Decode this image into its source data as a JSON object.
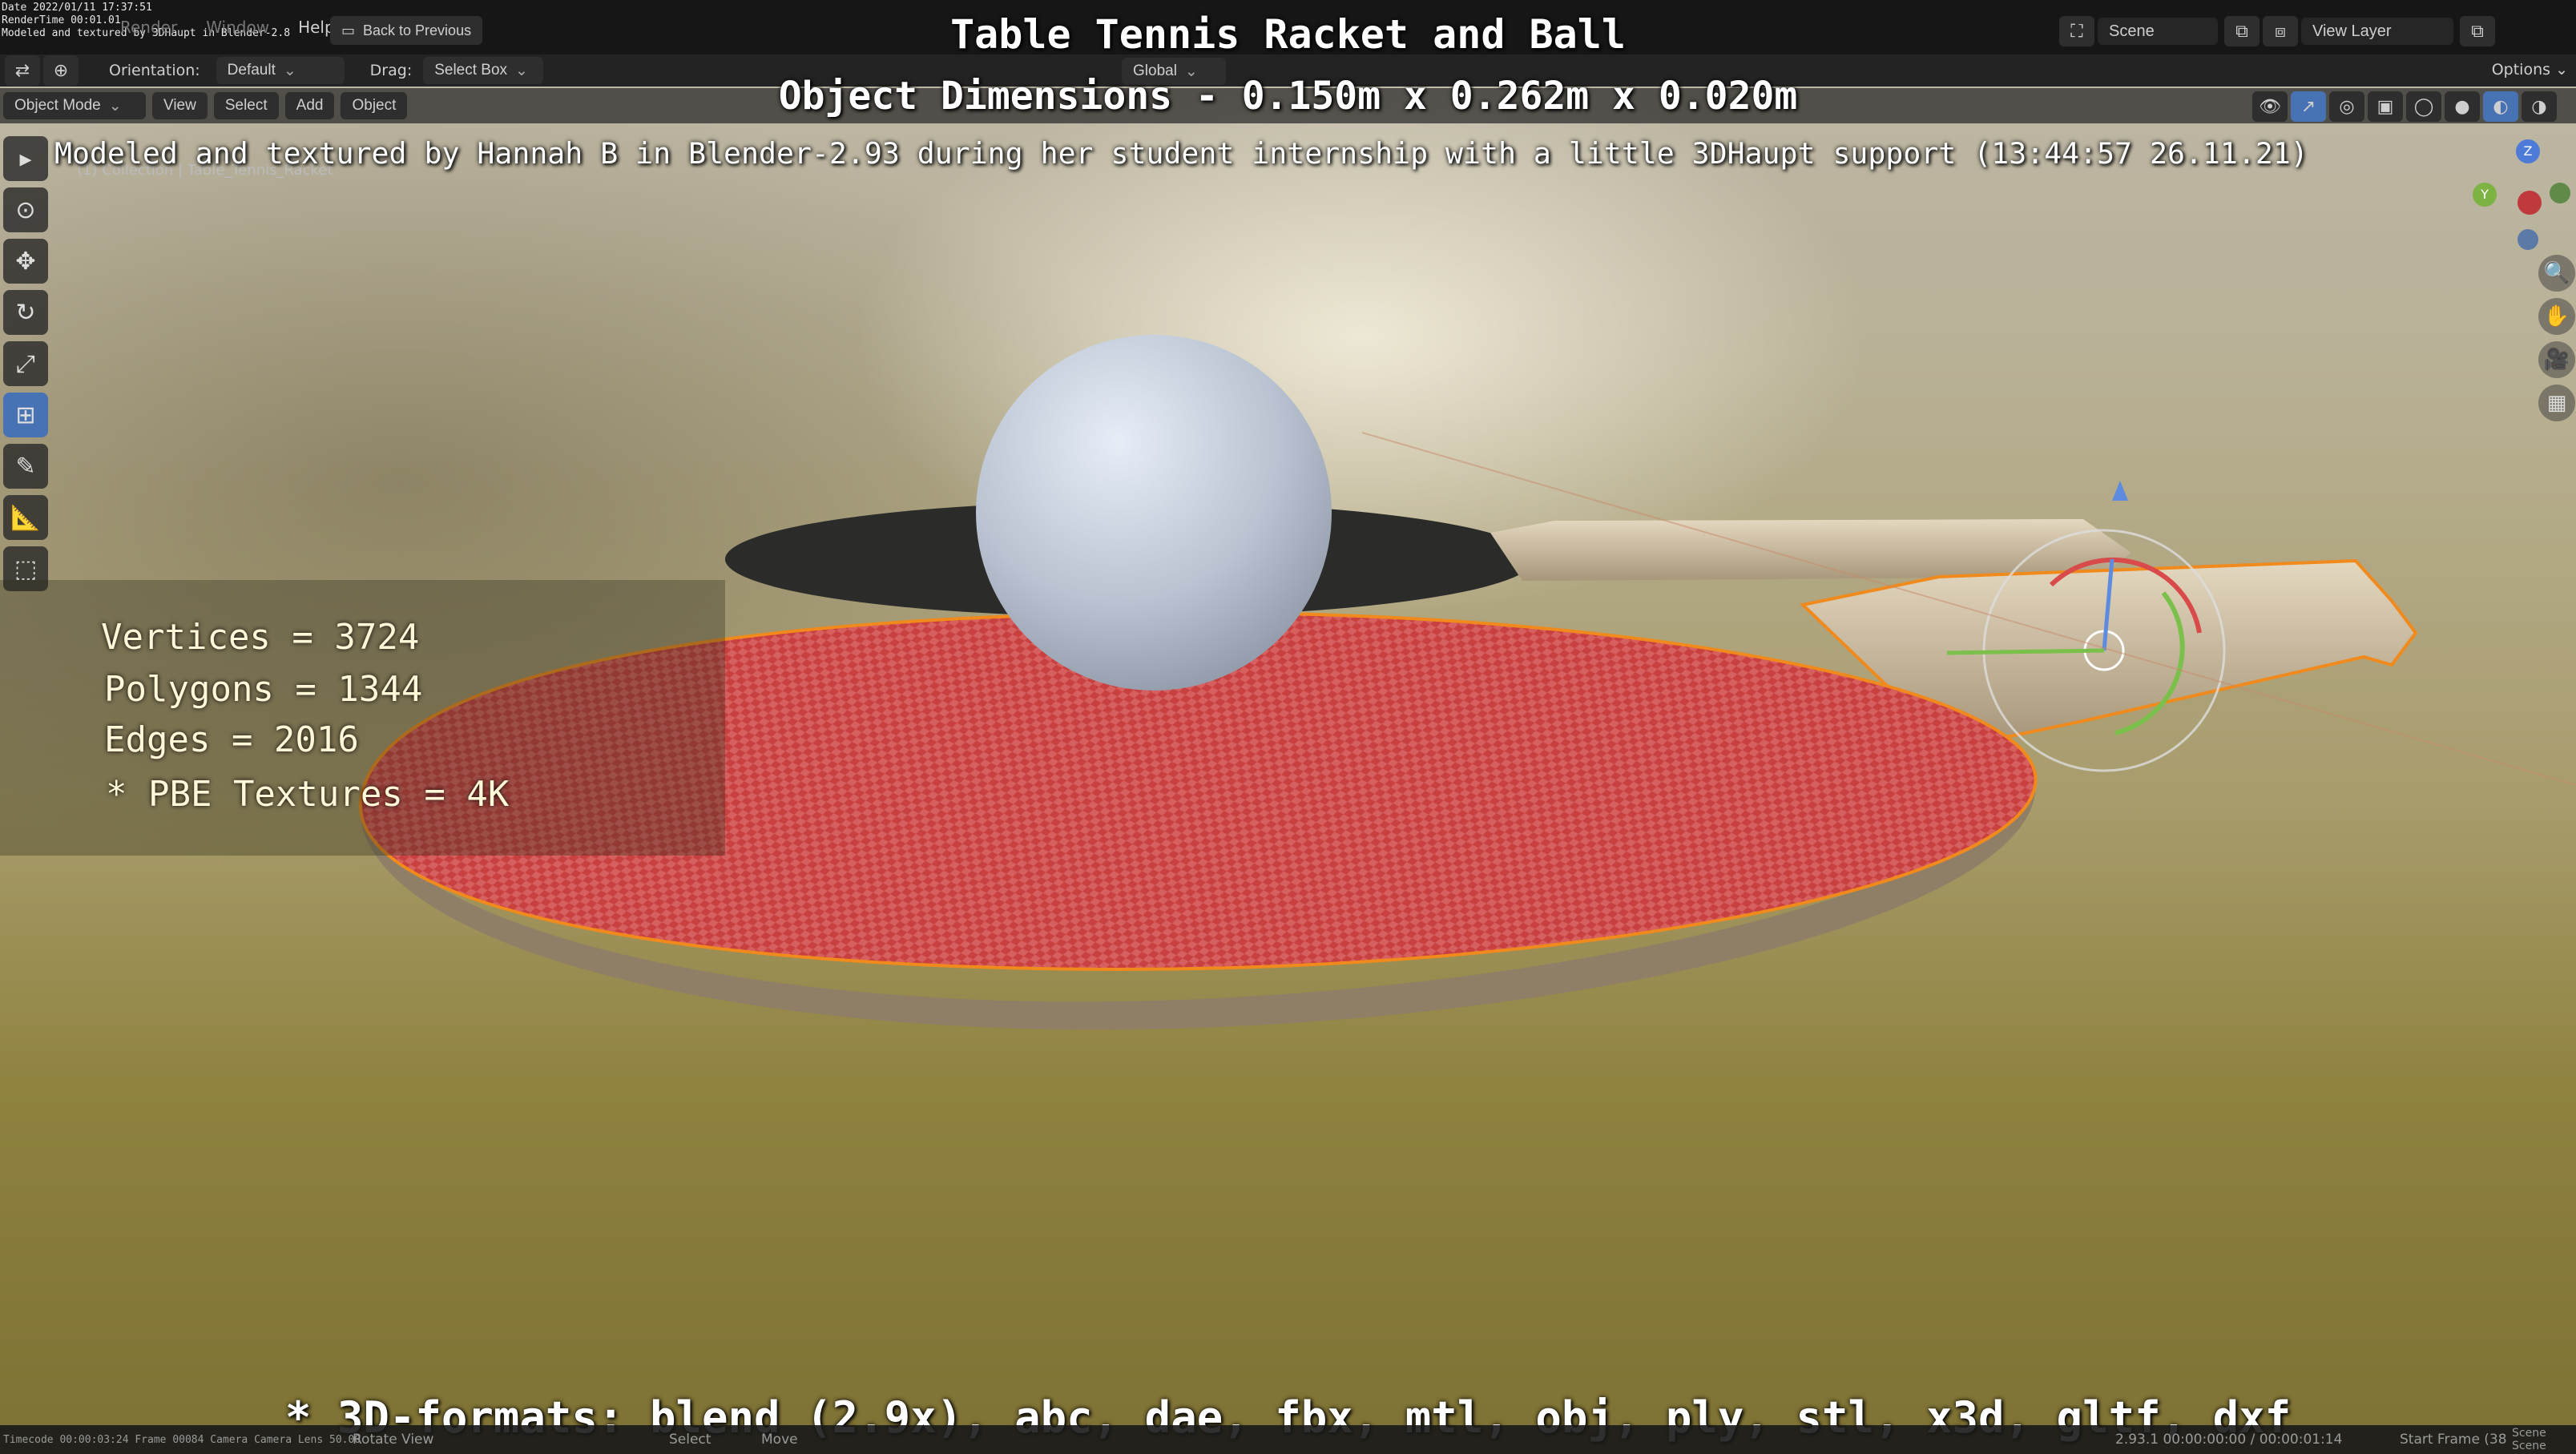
{
  "topbar": {
    "menu": [
      "Render",
      "Window",
      "Help"
    ],
    "back_button": "Back to Previous",
    "scene_label": "Scene",
    "view_layer_label": "View Layer",
    "stamp_lines": [
      "Date 2022/01/11 17:37:51",
      "RenderTime 00:01.01",
      "Modeled and textured by 3DHaupt in Blender-2.8"
    ]
  },
  "toolheader": {
    "orientation_label": "Orientation:",
    "orientation_value": "Default",
    "drag_label": "Drag:",
    "drag_value": "Select Box",
    "transform_value": "Global",
    "options_label": "Options"
  },
  "modeheader": {
    "mode": "Object Mode",
    "menus": [
      "View",
      "Select",
      "Add",
      "Object"
    ],
    "collection_path": "(1) Collection | Table_Tennis_Racket"
  },
  "overlay": {
    "title": "Table Tennis Racket and Ball",
    "dimensions": "Object Dimensions -  0.150m x 0.262m x 0.020m",
    "credits": "Modeled and textured by Hannah B in Blender-2.93 during her student internship with a little 3DHaupt support (13:44:57 26.11.21)",
    "vertices": "Vertices = 3724",
    "polygons": "Polygons = 1344",
    "edges": "Edges = 2016",
    "textures": "* PBE Textures = 4K",
    "formats": "* 3D-formats: blend (2.9x), abc, dae, fbx, mtl, obj, ply, stl, x3d, gltf, dxf"
  },
  "statusbar": {
    "left": "Timecode 00:00:03:24   Frame 00084   Camera Camera   Lens 50.00",
    "rotate": "Rotate View",
    "select": "Select",
    "move": "Move",
    "version": "2.93.1   00:00:00:00 / 00:00:01:14",
    "start_frame": "Start Frame (38",
    "scene_info": "Scene Scene"
  },
  "colors": {
    "accent": "#4772b3",
    "racket_red": "#c9403f",
    "selection_orange": "#f08a1c"
  }
}
